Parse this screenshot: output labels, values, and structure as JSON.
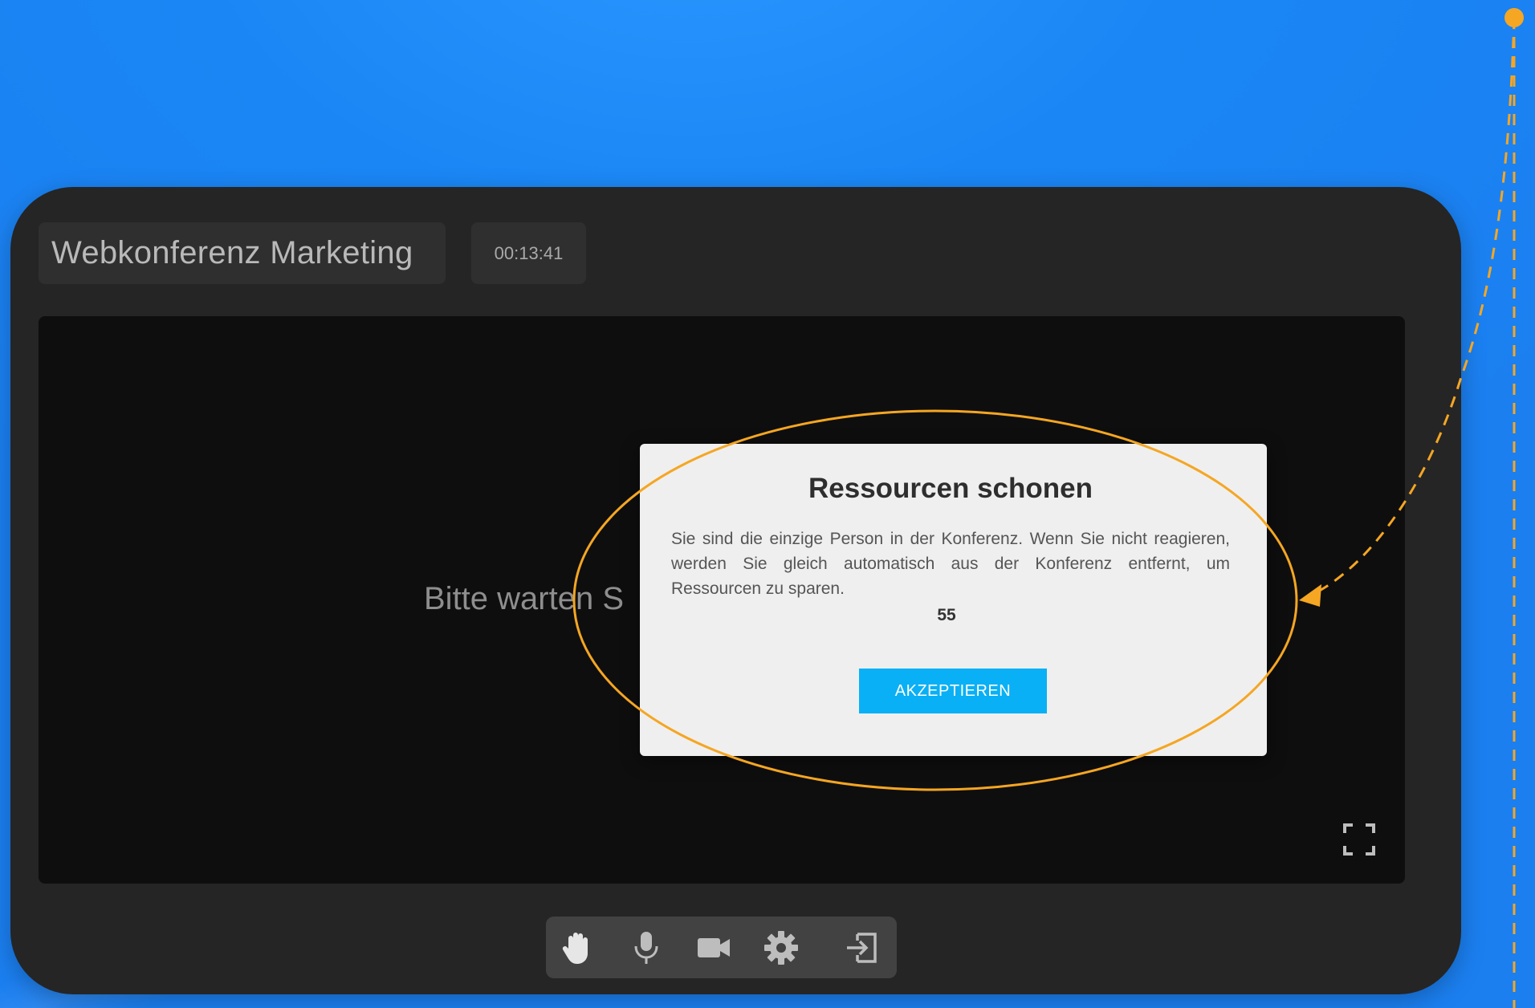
{
  "conference": {
    "title": "Webkonferenz Marketing",
    "timer": "00:13:41",
    "waiting_text": "Bitte warten S"
  },
  "dialog": {
    "title": "Ressourcen schonen",
    "message": "Sie sind die einzige Person in der Konferenz. Wenn Sie nicht reagieren, werden Sie gleich automatisch aus der Konferenz entfernt, um Ressourcen zu sparen.",
    "countdown": "55",
    "accept_label": "AKZEPTIEREN"
  },
  "toolbar": {
    "items": [
      {
        "icon": "raise-hand-icon"
      },
      {
        "icon": "microphone-icon"
      },
      {
        "icon": "camera-icon"
      },
      {
        "icon": "gear-icon"
      },
      {
        "icon": "leave-icon"
      }
    ]
  },
  "stage": {
    "fullscreen_icon": "fullscreen-icon"
  },
  "colors": {
    "background": "#1b86f5",
    "frame": "#252525",
    "accent_button": "#0ab0f5",
    "annotation": "#f5a623"
  }
}
